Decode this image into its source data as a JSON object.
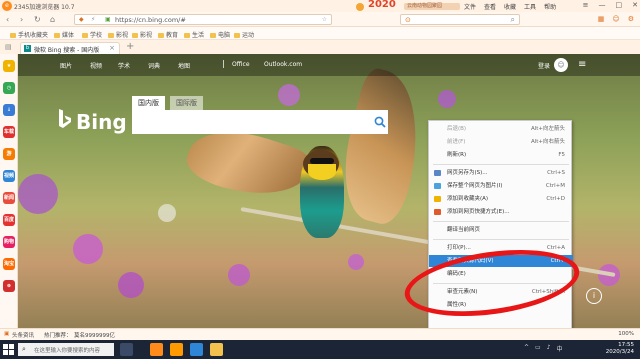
{
  "app": {
    "title": "2345加速浏览器 10.7",
    "logo_letter": "e",
    "deco_text": "2020",
    "deco_sub": "云南动物园聚园",
    "menu": [
      "文件",
      "查看",
      "收藏",
      "工具",
      "帮助"
    ]
  },
  "window_controls": {
    "menu": "≡",
    "minimize": "—",
    "maximize": "□",
    "close": "✕"
  },
  "address": {
    "url": "https://cn.bing.com/#",
    "search_placeholder": "",
    "nav": {
      "back": "‹",
      "forward": "›",
      "refresh": "↻",
      "home": "⌂"
    }
  },
  "bookmarks": [
    "手机收藏夹",
    "媒体",
    "学校",
    "影视",
    "影视",
    "教育",
    "生活",
    "电脑",
    "运动"
  ],
  "tabs": [
    {
      "title": "微软 Bing 搜索 - 国内版",
      "icon": "b",
      "close": "×"
    }
  ],
  "new_tab": "+",
  "sidebar": [
    {
      "name": "star",
      "label": "★",
      "color": "#f0b400"
    },
    {
      "name": "clock",
      "label": "◷",
      "color": "#35a853"
    },
    {
      "name": "download",
      "label": "↓",
      "color": "#3a7bd5"
    },
    {
      "name": "music",
      "label": "车载",
      "color": "#e03030"
    },
    {
      "name": "game",
      "label": "游",
      "color": "#f57c00"
    },
    {
      "name": "video",
      "label": "视频",
      "color": "#2f86d6"
    },
    {
      "name": "news",
      "label": "新闻",
      "color": "#e94b3c"
    },
    {
      "name": "shop",
      "label": "百度",
      "color": "#e63131"
    },
    {
      "name": "hao",
      "label": "购物",
      "color": "#e91e63"
    },
    {
      "name": "tao",
      "label": "淘宝",
      "color": "#ff6a00"
    },
    {
      "name": "other",
      "label": "⊕",
      "color": "#d32f2f"
    }
  ],
  "bing": {
    "nav": [
      "图片",
      "视频",
      "学术",
      "词典",
      "地图",
      "Office",
      "Outlook.com"
    ],
    "login": "登录",
    "logo": "Bing",
    "search_tabs": [
      "国内版",
      "国际版"
    ],
    "info_icon": "i"
  },
  "context_menu": [
    {
      "label": "后退(B)",
      "key": "Alt+向左箭头",
      "disabled": true,
      "icon": ""
    },
    {
      "label": "前进(F)",
      "key": "Alt+向右箭头",
      "disabled": true,
      "icon": ""
    },
    {
      "label": "刷新(R)",
      "key": "F5",
      "disabled": false,
      "icon": ""
    },
    {
      "sep": true
    },
    {
      "label": "网页另存为(S)...",
      "key": "Ctrl+S",
      "disabled": false,
      "icon": "#5b87c7"
    },
    {
      "label": "保存整个网页为图片(I)",
      "key": "Ctrl+M",
      "disabled": false,
      "icon": "#4aa3df"
    },
    {
      "label": "添加到收藏夹(A)",
      "key": "Ctrl+D",
      "disabled": false,
      "icon": "#f0b400"
    },
    {
      "label": "添加到网页快捷方式(E)...",
      "key": "",
      "disabled": false,
      "icon": "#e05a2b"
    },
    {
      "sep": true
    },
    {
      "label": "翻译当前网页",
      "key": "",
      "disabled": false,
      "icon": ""
    },
    {
      "sep": true
    },
    {
      "label": "打印(P)...",
      "key": "Ctrl+A",
      "disabled": false,
      "icon": ""
    },
    {
      "label": "查看网页源代码(V)",
      "key": "Ctrl+",
      "disabled": false,
      "icon": "",
      "highlight": true
    },
    {
      "label": "编码(E)",
      "key": "",
      "disabled": false,
      "icon": ""
    },
    {
      "sep": true
    },
    {
      "label": "审查元素(N)",
      "key": "Ctrl+Shift+I",
      "disabled": false,
      "icon": ""
    },
    {
      "label": "属性(R)",
      "key": "",
      "disabled": false,
      "icon": ""
    }
  ],
  "status": {
    "news": "头条资讯",
    "hot": "热门推荐：",
    "text": "莫名9999999亿",
    "zoom": "100%"
  },
  "taskbar": {
    "search_placeholder": "在这里输入你要搜索的内容",
    "apps": [
      {
        "name": "task-view",
        "color": "#3b4a66"
      },
      {
        "name": "browser",
        "color": "#ff8b1a"
      },
      {
        "name": "ai",
        "color": "#ff9a00"
      },
      {
        "name": "paint",
        "color": "#2f86d6"
      },
      {
        "name": "explorer",
        "color": "#f2c14e"
      }
    ],
    "time": "17:55",
    "date": "2020/3/24"
  },
  "colors": {
    "accent": "#2f86d6",
    "highlight_circle": "#e81616",
    "browser_bg": "#fff1e4"
  }
}
